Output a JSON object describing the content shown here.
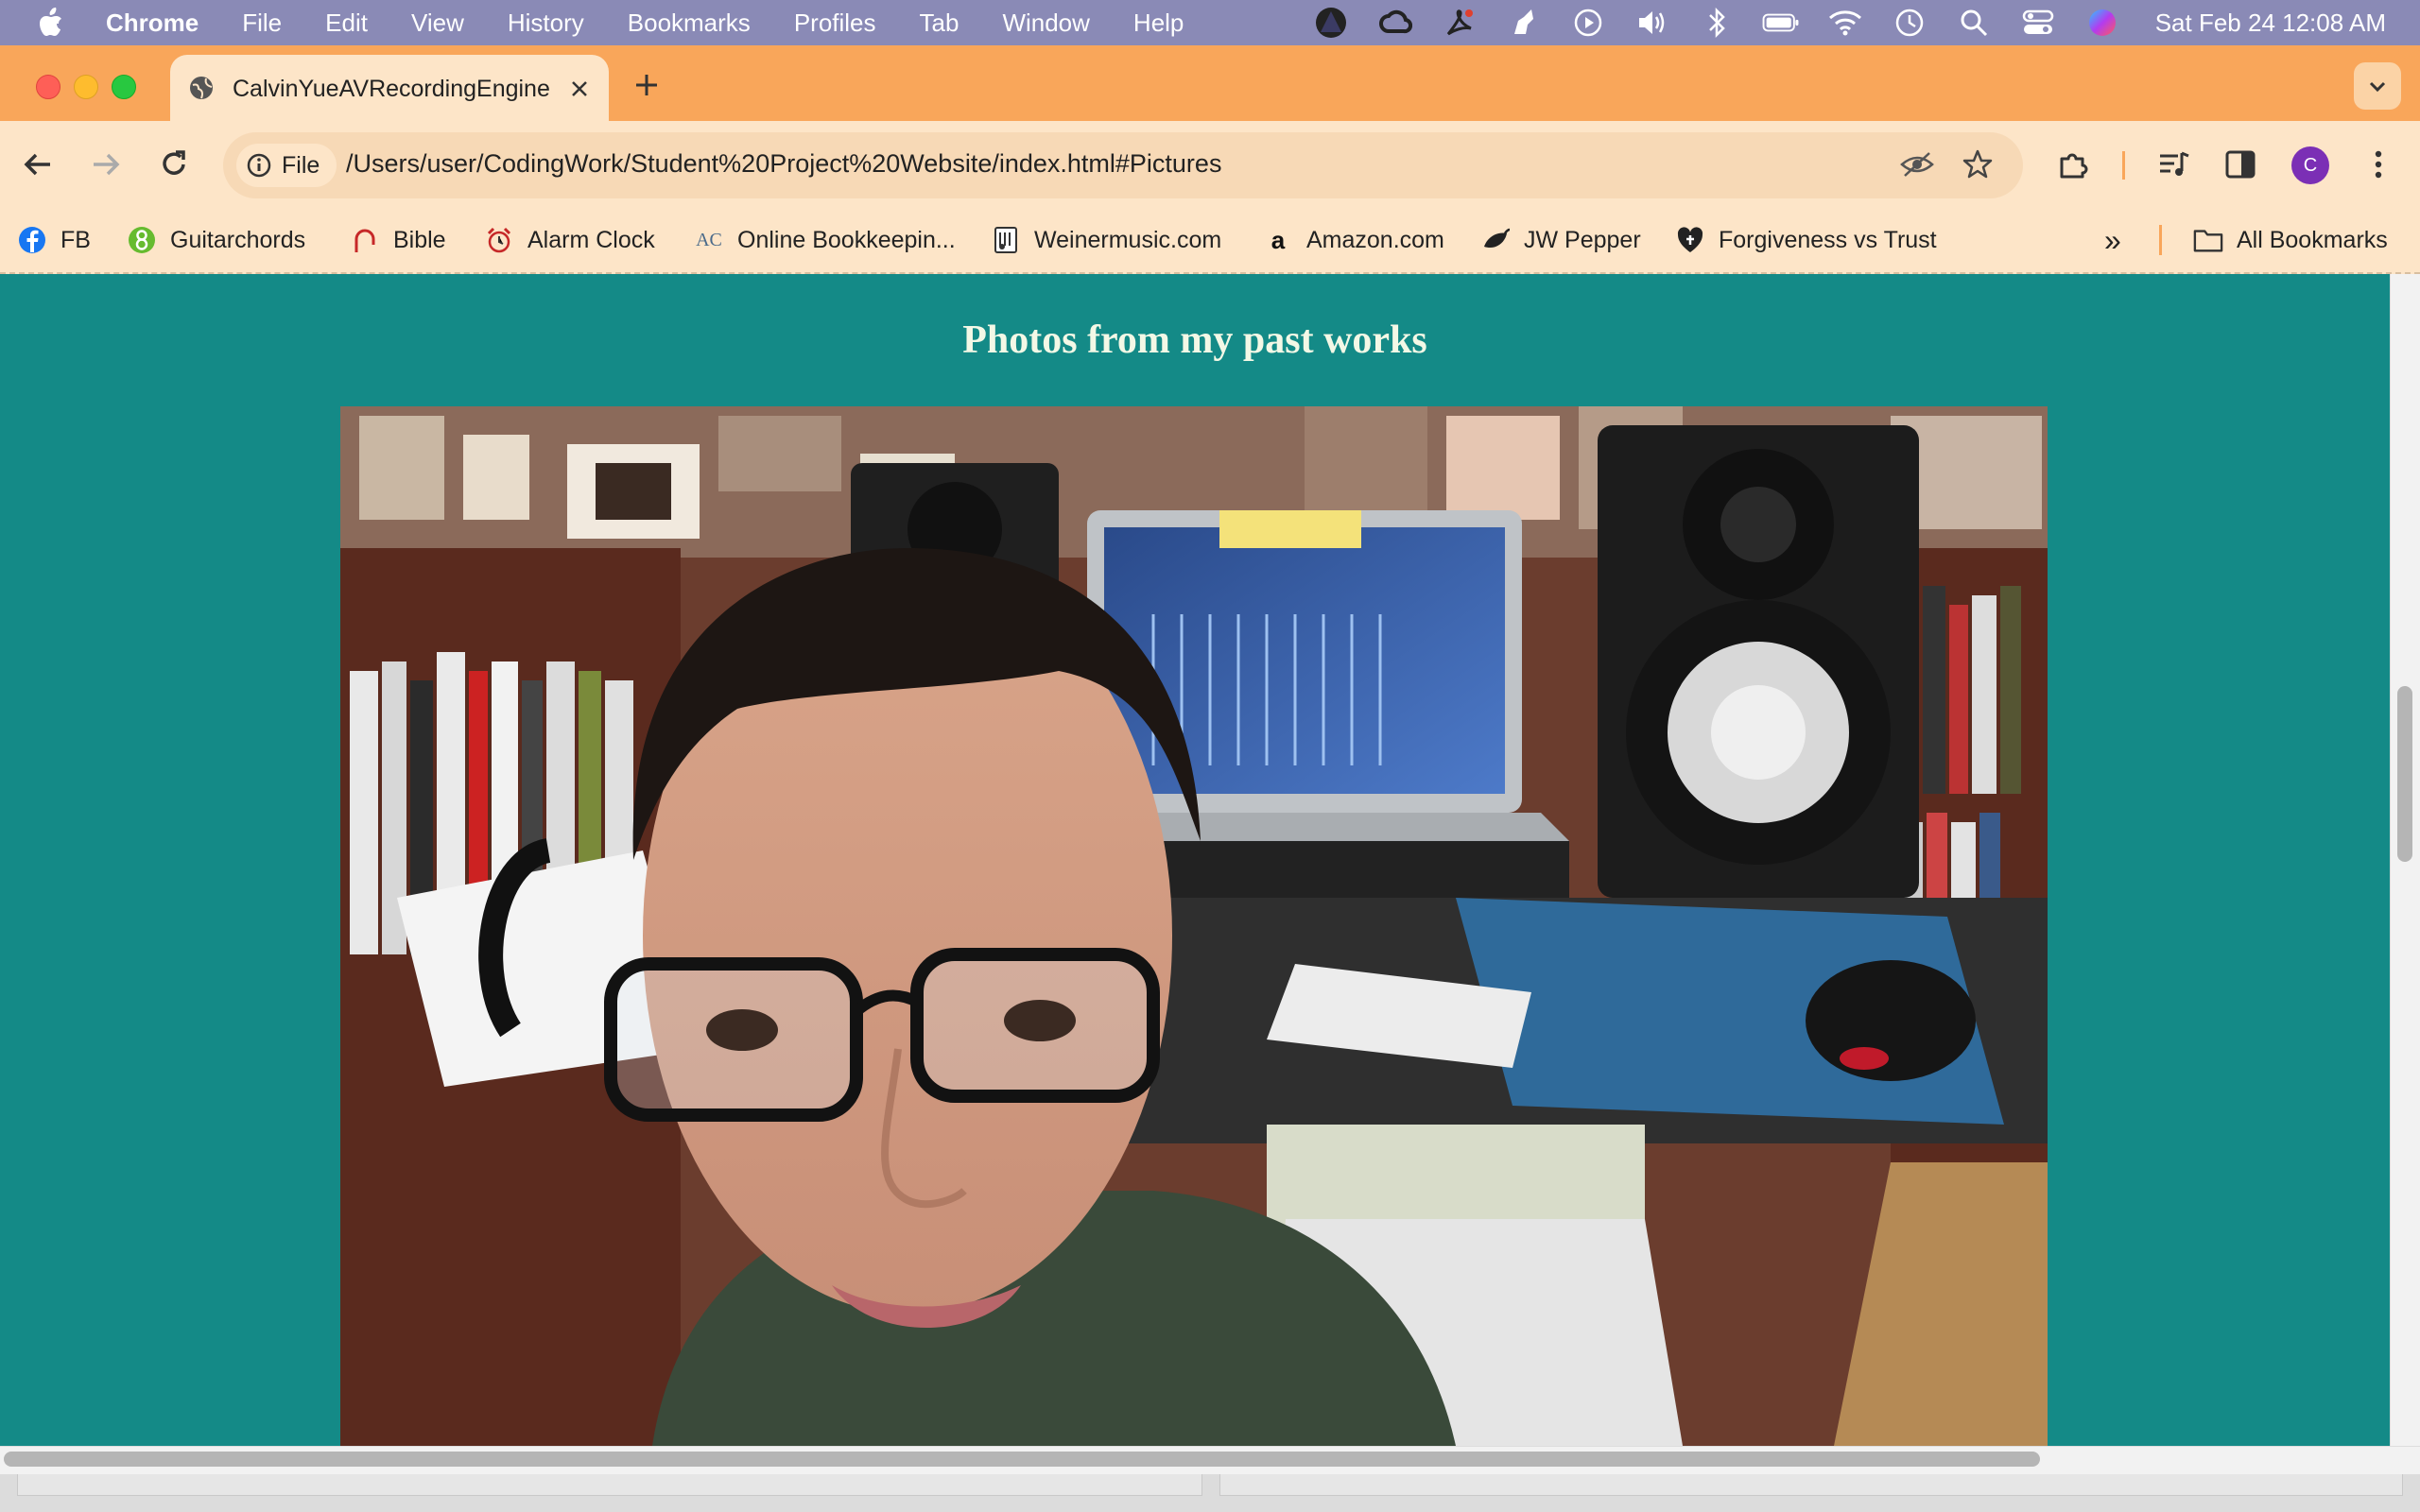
{
  "menubar": {
    "items": [
      "Chrome",
      "File",
      "Edit",
      "View",
      "History",
      "Bookmarks",
      "Profiles",
      "Tab",
      "Window",
      "Help"
    ],
    "clock": "Sat Feb 24  12:08 AM"
  },
  "tab": {
    "title": "CalvinYueAVRecordingEngine",
    "close": "×",
    "new_tab": "+"
  },
  "omnibox": {
    "scheme_label": "File",
    "url": "/Users/user/CodingWork/Student%20Project%20Website/index.html#Pictures"
  },
  "profile": {
    "initial": "C",
    "color": "#7b2fb5"
  },
  "bookmarks": {
    "items": [
      "FB",
      "Guitarchords",
      "Bible",
      "Alarm Clock",
      "Online Bookkeepin...",
      "Weinermusic.com",
      "Amazon.com",
      "JW Pepper",
      "Forgiveness vs Trust"
    ],
    "overflow": "»",
    "all_bookmarks": "All Bookmarks"
  },
  "page": {
    "heading": "Photos from my past works"
  },
  "colors": {
    "menubar": "#8a8ab6",
    "tabstrip": "#f9a65a",
    "toolbar": "#fde5c8",
    "page_bg": "#148a87",
    "heading": "#f3f8e6"
  }
}
